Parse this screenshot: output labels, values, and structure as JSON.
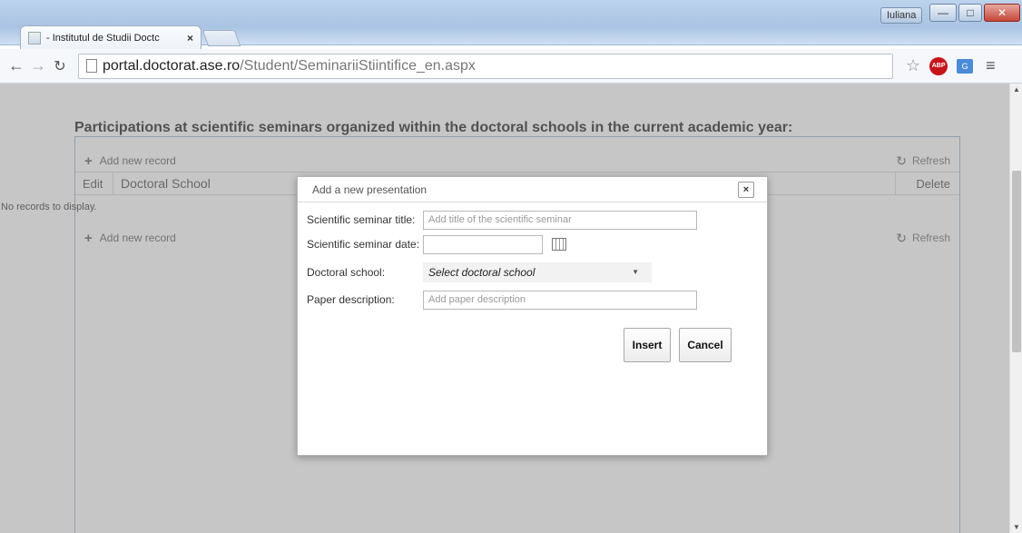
{
  "browser": {
    "tab_title": "- Institutul de Studii Doctc",
    "tab_close": "×",
    "user_name": "Iuliana",
    "url_host": "portal.doctorat.ase.ro",
    "url_path": "/Student/SeminariiStiintifice_en.aspx",
    "abp_label": "ABP",
    "ext_label": "G",
    "icons": [
      "back-arrow-icon",
      "forward-arrow-icon",
      "reload-icon",
      "page-icon",
      "star-icon",
      "adblock-icon",
      "translate-icon",
      "menu-icon"
    ]
  },
  "page": {
    "heading": "Participations at scientific seminars organized within the doctoral schools in the current academic year:",
    "add_new_record": "Add new record",
    "refresh": "Refresh",
    "columns": {
      "edit": "Edit",
      "doctoral_school": "Doctoral School",
      "delete": "Delete"
    },
    "no_records": "No records to display."
  },
  "modal": {
    "title": "Add a new presentation",
    "close": "×",
    "fields": {
      "seminar_title_label": "Scientific seminar title:",
      "seminar_title_placeholder": "Add title of the scientific seminar",
      "seminar_date_label": "Scientific seminar date:",
      "doctoral_school_label": "Doctoral school:",
      "doctoral_school_selected": "Select doctoral school",
      "paper_description_label": "Paper description:",
      "paper_description_placeholder": "Add paper description"
    },
    "insert_label": "Insert",
    "cancel_label": "Cancel"
  },
  "colors": {
    "accent_border": "#9fb4d6",
    "overlay": "#808080",
    "close_red": "#c5463a"
  }
}
